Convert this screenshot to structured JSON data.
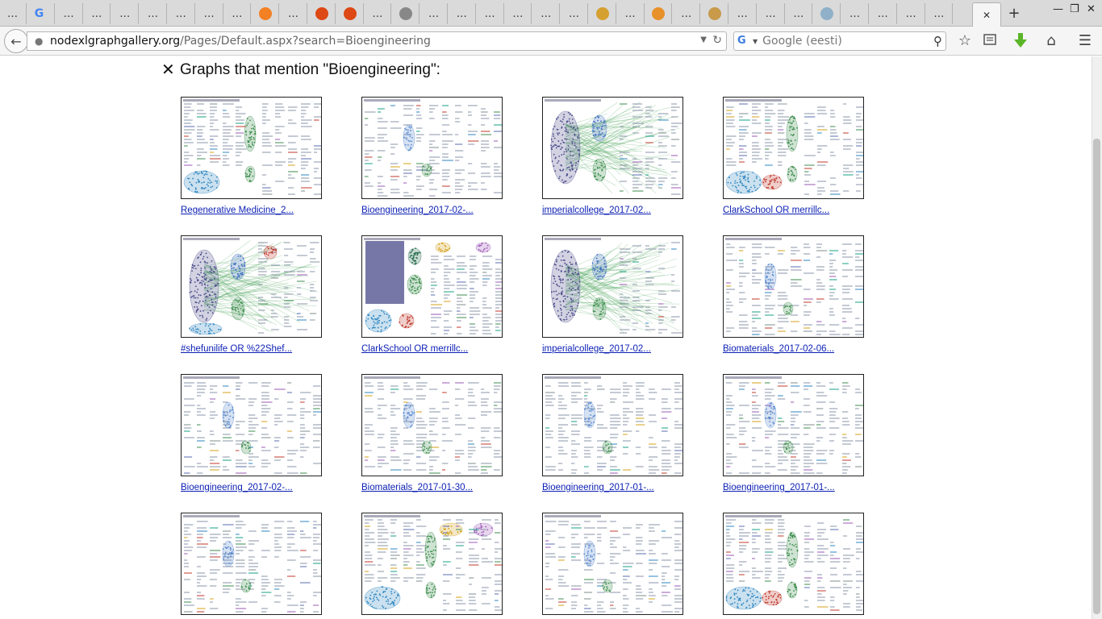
{
  "browser": {
    "tabs": [
      {
        "label": "…",
        "icon": "none"
      },
      {
        "label": "",
        "icon": "google-icon"
      },
      {
        "label": "…",
        "icon": "none"
      },
      {
        "label": "…",
        "icon": "none"
      },
      {
        "label": "…",
        "icon": "none"
      },
      {
        "label": "…",
        "icon": "none"
      },
      {
        "label": "…",
        "icon": "none"
      },
      {
        "label": "…",
        "icon": "none"
      },
      {
        "label": "…",
        "icon": "none"
      },
      {
        "label": "",
        "icon": "stackoverflow-icon"
      },
      {
        "label": "…",
        "icon": "none"
      },
      {
        "label": "",
        "icon": "ubuntu-icon"
      },
      {
        "label": "",
        "icon": "ubuntu-icon"
      },
      {
        "label": "…",
        "icon": "none"
      },
      {
        "label": "",
        "icon": "github-icon"
      },
      {
        "label": "…",
        "icon": "none"
      },
      {
        "label": "…",
        "icon": "none"
      },
      {
        "label": "…",
        "icon": "none"
      },
      {
        "label": "…",
        "icon": "none"
      },
      {
        "label": "…",
        "icon": "none"
      },
      {
        "label": "…",
        "icon": "none"
      },
      {
        "label": "",
        "icon": "jar-icon"
      },
      {
        "label": "…",
        "icon": "none"
      },
      {
        "label": "",
        "icon": "bird-icon"
      },
      {
        "label": "…",
        "icon": "none"
      },
      {
        "label": "",
        "icon": "archive-icon"
      },
      {
        "label": "…",
        "icon": "none"
      },
      {
        "label": "…",
        "icon": "none"
      },
      {
        "label": "…",
        "icon": "none"
      },
      {
        "label": "",
        "icon": "cloud-icon"
      },
      {
        "label": "…",
        "icon": "none"
      },
      {
        "label": "…",
        "icon": "none"
      },
      {
        "label": "…",
        "icon": "none"
      },
      {
        "label": "…",
        "icon": "none"
      },
      {
        "label": "",
        "icon": "close-icon",
        "active": true
      }
    ],
    "url_host": "nodexlgraphgallery.org",
    "url_path": "/Pages/Default.aspx?search=Bioengineering",
    "search_placeholder": "Google (eesti)",
    "new_tab": "+",
    "close_tab": "✕"
  },
  "page": {
    "heading": "Graphs that mention \"Bioengineering\":",
    "close_symbol": "✕",
    "graphs": [
      {
        "caption": "Regenerative Medicine_2...",
        "style": "mixed-a"
      },
      {
        "caption": "Bioengineering_2017-02-...",
        "style": "text"
      },
      {
        "caption": "imperialcollege_2017-02...",
        "style": "hub"
      },
      {
        "caption": "ClarkSchool OR merrillc...",
        "style": "mixed-b"
      },
      {
        "caption": "#shefunilife OR %22Shef...",
        "style": "hub2"
      },
      {
        "caption": "ClarkSchool OR merrillc...",
        "style": "dense"
      },
      {
        "caption": "imperialcollege_2017-02...",
        "style": "hub"
      },
      {
        "caption": "Biomaterials_2017-02-06...",
        "style": "text"
      },
      {
        "caption": "Bioengineering_2017-02-...",
        "style": "text"
      },
      {
        "caption": "Biomaterials_2017-01-30...",
        "style": "text"
      },
      {
        "caption": "Bioengineering_2017-01-...",
        "style": "text"
      },
      {
        "caption": "Bioengineering_2017-01-...",
        "style": "text"
      },
      {
        "caption": "",
        "style": "text"
      },
      {
        "caption": "",
        "style": "mixed-c"
      },
      {
        "caption": "",
        "style": "text"
      },
      {
        "caption": "",
        "style": "mixed-b"
      }
    ]
  },
  "colors": {
    "link": "#0b1fb4",
    "tabbar": "#dadada",
    "download_arrow": "#5bb528"
  }
}
